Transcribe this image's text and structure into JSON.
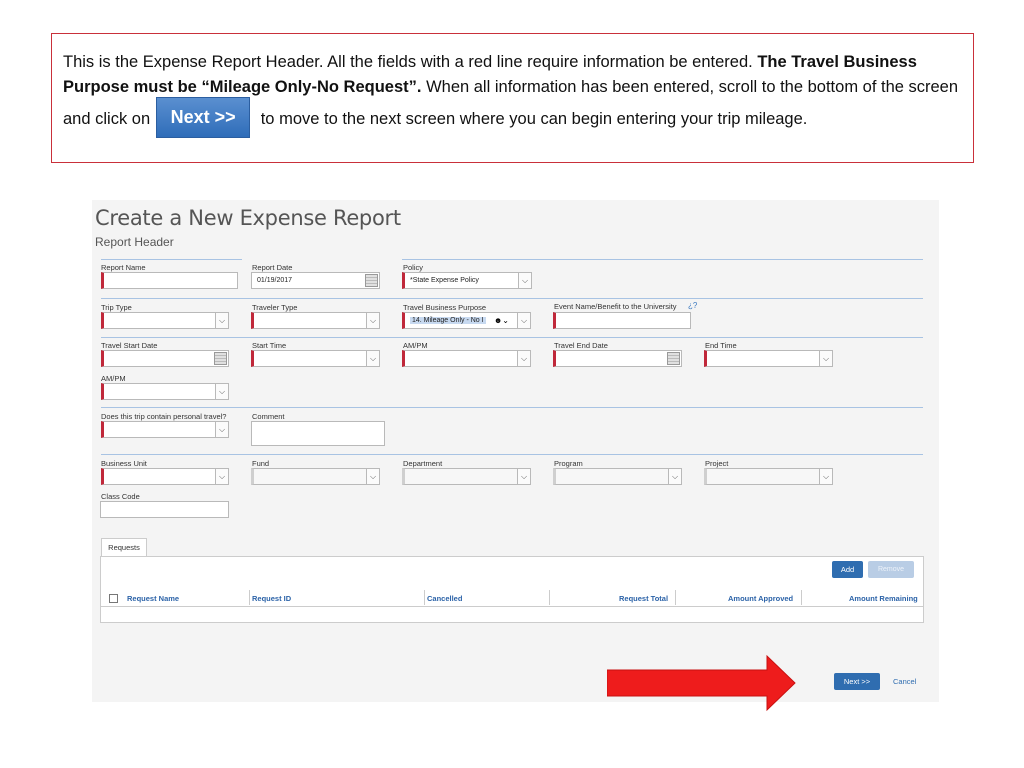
{
  "callout": {
    "t1": "This is the Expense Report Header.  All the fields with a red line require information be entered. ",
    "b1": "The Travel Business Purpose must be “Mileage Only-No Request”.",
    "t2": "  When all information has been entered, scroll to the bottom of the screen and click on",
    "button_image_label": "Next >>",
    "t3": " to move to the next screen where you can begin entering your trip mileage."
  },
  "screen": {
    "title": "Create a New Expense Report",
    "subtitle": "Report Header",
    "fields": {
      "report_name": {
        "label": "Report Name",
        "value": ""
      },
      "report_date": {
        "label": "Report Date",
        "value": "01/19/2017"
      },
      "policy": {
        "label": "Policy",
        "value": "*State Expense Policy"
      },
      "trip_type": {
        "label": "Trip Type",
        "value": ""
      },
      "traveler_type": {
        "label": "Traveler Type",
        "value": ""
      },
      "travel_business_purpose": {
        "label": "Travel Business Purpose",
        "value": "14.  Mileage Only - No I"
      },
      "event_name": {
        "label": "Event Name/Benefit to the University",
        "value": ""
      },
      "travel_start_date": {
        "label": "Travel Start Date",
        "value": ""
      },
      "start_time": {
        "label": "Start Time",
        "value": ""
      },
      "start_ampm": {
        "label": "AM/PM",
        "value": ""
      },
      "travel_end_date": {
        "label": "Travel End Date",
        "value": ""
      },
      "end_time": {
        "label": "End Time",
        "value": ""
      },
      "end_ampm": {
        "label": "AM/PM",
        "value": ""
      },
      "personal_travel": {
        "label": "Does this trip contain personal travel?",
        "value": ""
      },
      "comment": {
        "label": "Comment",
        "value": ""
      },
      "business_unit": {
        "label": "Business Unit",
        "value": ""
      },
      "fund": {
        "label": "Fund",
        "value": ""
      },
      "department": {
        "label": "Department",
        "value": ""
      },
      "program": {
        "label": "Program",
        "value": ""
      },
      "project": {
        "label": "Project",
        "value": ""
      },
      "class_code": {
        "label": "Class Code",
        "value": ""
      }
    },
    "help_glyph": "¿?",
    "requests": {
      "tab_label": "Requests",
      "add_label": "Add",
      "remove_label": "Remove",
      "columns": [
        "Request Name",
        "Request ID",
        "Cancelled",
        "Request Total",
        "Amount Approved",
        "Amount Remaining"
      ]
    },
    "footer": {
      "next_label": "Next >>",
      "cancel_label": "Cancel"
    }
  },
  "colors": {
    "required": "#c0283a",
    "accent": "#2f6db0",
    "arrow": "#ee1c1c",
    "callout_border": "#c9303a"
  }
}
